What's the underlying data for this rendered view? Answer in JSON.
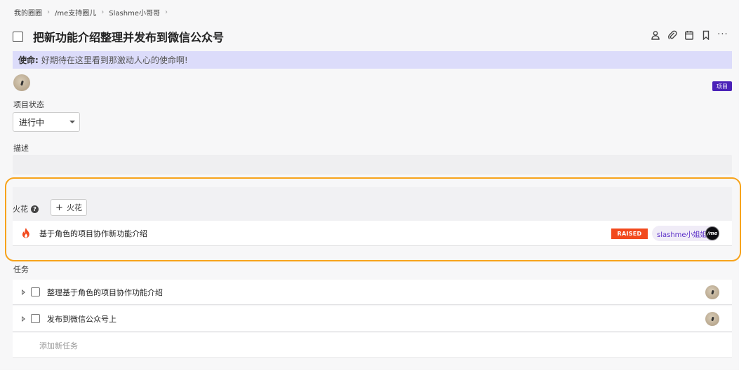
{
  "breadcrumb": [
    "我的圈圈",
    "/me支持圈儿",
    "Slashme小哥哥"
  ],
  "title": "把新功能介绍整理并发布到微信公众号",
  "actions": [
    "person-icon",
    "paperclip-icon",
    "calendar-icon",
    "bookmark-icon",
    "more-icon"
  ],
  "mission": {
    "label": "使命:",
    "text": "好期待在这里看到那激动人心的使命啊!"
  },
  "tag": "项目",
  "status": {
    "label": "项目状态",
    "value": "进行中"
  },
  "description": {
    "label": "描述"
  },
  "sparks": {
    "label": "火花",
    "add_label": "火花",
    "items": [
      {
        "title": "基于角色的项目协作新功能介绍",
        "status": "RAISED",
        "owner": "slashme小姐姐",
        "owner_avatar": "/me"
      }
    ]
  },
  "tasks": {
    "label": "任务",
    "items": [
      {
        "title": "整理基于角色的项目协作功能介绍"
      },
      {
        "title": "发布到微信公众号上"
      }
    ],
    "add_placeholder": "添加新任务"
  },
  "colors": {
    "highlight": "#f7a31b",
    "mission_bg": "#dcdcfa",
    "tag_bg": "#4b22b8",
    "raised_bg": "#f24a1e"
  }
}
